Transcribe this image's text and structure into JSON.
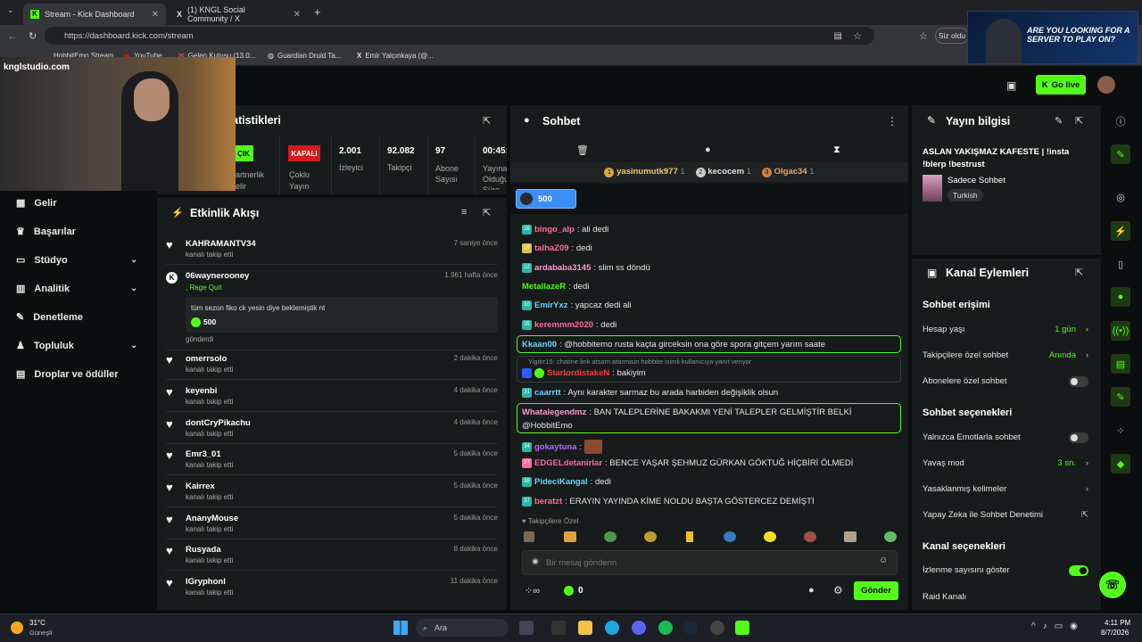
{
  "browser": {
    "tabs": [
      {
        "label": "Stream - Kick Dashboard"
      },
      {
        "label": "(1) KNGL Social Community / X"
      }
    ],
    "url": "https://dashboard.kick.com/stream",
    "bookmarks": [
      "HobbitEmo Stream",
      "YouTube",
      "Gelen Kutusu (13.0...",
      "Guardian Druid Ta...",
      "Emir Yalçınkaya (@..."
    ],
    "profile_text": "Siz oldu",
    "ad_text": "ARE YOU LOOKING FOR A SERVER TO PLAY ON?"
  },
  "overlay": {
    "watermark": "knglstudio.com"
  },
  "topbar": {
    "go_live": "Go live"
  },
  "sidebar": {
    "items": [
      {
        "label": "Gelir",
        "icon": "revenue-icon"
      },
      {
        "label": "Başarılar",
        "icon": "trophy-icon"
      },
      {
        "label": "Stüdyo",
        "icon": "studio-icon"
      },
      {
        "label": "Analitik",
        "icon": "chart-icon"
      },
      {
        "label": "Denetleme",
        "icon": "wrench-icon"
      },
      {
        "label": "Topluluk",
        "icon": "community-icon"
      },
      {
        "label": "Droplar ve ödüller",
        "icon": "gift-icon"
      }
    ]
  },
  "stats": {
    "title_fragment": "atistikleri",
    "partner_status": "ÇIK",
    "partner_label": "artnerlik\nelir",
    "multistream_status": "KAPALI",
    "multistream_label": "Çoklu\nYayın",
    "viewers": "2.001",
    "viewers_label": "İzleyici",
    "followers": "92.082",
    "followers_label": "Takipçi",
    "subs": "97",
    "subs_label": "Abone\nSayısı",
    "uptime": "00:45:",
    "uptime_label": "Yayına\nOlduğu\nSüre"
  },
  "activity": {
    "title": "Etkinlik Akışı",
    "items": [
      {
        "name": "KAHRAMANTV34",
        "sub": "kanalı takip etti",
        "time": "7 saniye önce"
      },
      {
        "name": "omerrsolo",
        "sub": "kanalı takip etti",
        "time": "2 dakika önce"
      },
      {
        "name": "keyenbi",
        "sub": "kanalı takip etti",
        "time": "4 dakika önce"
      },
      {
        "name": "dontCryPikachu",
        "sub": "kanalı takip etti",
        "time": "4 dakika önce"
      },
      {
        "name": "Emr3_01",
        "sub": "kanalı takip etti",
        "time": "5 dakika önce"
      },
      {
        "name": "Kairrex",
        "sub": "kanalı takip etti",
        "time": "5 dakika önce"
      },
      {
        "name": "AnanyMouse",
        "sub": "kanalı takip etti",
        "time": "5 dakika önce"
      },
      {
        "name": "Rusyada",
        "sub": "kanalı takip etti",
        "time": "8 dakika önce"
      },
      {
        "name": "IGryphonl",
        "sub": "kanalı takip etti",
        "time": "11 dakika önce"
      }
    ],
    "special": {
      "name": "06waynerooney",
      "tag": ", Rage Quit",
      "time": "1.961 hafta önce",
      "message": "tüm sezon fiko ck yesin diye beklemiştik nt",
      "amount": "500",
      "footer": "gönderdi"
    }
  },
  "chat": {
    "title": "Sohbet",
    "top_gifters": [
      {
        "rank": "1",
        "name": "yasinumutk977",
        "count": "1"
      },
      {
        "rank": "2",
        "name": "kecocem",
        "count": "1"
      },
      {
        "rank": "3",
        "name": "Olgac34",
        "count": "1"
      }
    ],
    "pinned_amount": "500",
    "messages": [
      {
        "badge": "26",
        "user": "bingo_alp",
        "color": "#ff6b9d",
        "text": ": ali dedi"
      },
      {
        "badge": "16",
        "user": "talhaZ09",
        "color": "#ff6b9d",
        "text": ": dedi"
      },
      {
        "badge": "22",
        "user": "ardababa3145",
        "color": "#ff9bd6",
        "text": ": slim ss döndü"
      },
      {
        "badge": "",
        "user": "MetallazeR",
        "color": "#53fc18",
        "text": ": dedi"
      },
      {
        "badge": "30",
        "user": "EmirYxz",
        "color": "#6bd4ff",
        "text": ": yapcaz dedi ali"
      },
      {
        "badge": "35",
        "user": "keremmm2020",
        "color": "#ff6b9d",
        "text": ": dedi"
      },
      {
        "badge": "",
        "user": "Kkaan00",
        "color": "#6bd4ff",
        "text": ": @hobbitemo rusta kaçta girceksin ona göre spora gitçem yarım saate"
      },
      {
        "badge": "",
        "user": "StarlordistakeN",
        "color": "#ff3b3b",
        "text": ": bakiyim"
      },
      {
        "badge": "31",
        "user": "caarrtt",
        "color": "#6bd4ff",
        "text": ": Aynı karakter sarmaz bu arada harbiden değişiklik olsun"
      },
      {
        "badge": "",
        "user": "Whatalegendmz",
        "color": "#ff9bd6",
        "text": ": BAN TALEPLERİNE BAKAKMI YENİ TALEPLER GELMİŞTİR BELKİ"
      },
      {
        "badge": "",
        "user": "",
        "color": "#ffffff",
        "text": "@HobbitEmo"
      },
      {
        "badge": "34",
        "user": "gokaytuna",
        "color": "#b06bff",
        "text": ":"
      },
      {
        "badge": "27",
        "user": "EDGELdetanirlar",
        "color": "#ff6b9d",
        "text": ": BENCE YAŞAR ŞEHMUZ GÜRKAN GÖKTUĞ HİÇBİRİ ÖLMEDİ"
      },
      {
        "badge": "38",
        "user": "PideciKangal",
        "color": "#6bd4ff",
        "text": ": dedi"
      },
      {
        "badge": "37",
        "user": "beratzt",
        "color": "#ff6b9d",
        "text": ": ERAYIN YAYINDA KİME NOLDU BAŞTA GÖSTERCEZ DEMİŞTİ"
      }
    ],
    "reply_ref": "Yigitrr15: chatine link atsam atarmisin hobbite isimli kullanıcıya yanıt veriyor",
    "followers_only": "Takipçilere Özel",
    "input_placeholder": "Bir mesaj gönderin",
    "points": "0",
    "send": "Gönder"
  },
  "stream_info": {
    "title": "Yayın bilgisi",
    "stream_title": "ASLAN YAKIŞMAZ KAFESTE | !insta !blerp !bestrust",
    "category": "Sadece Sohbet",
    "tag": "Turkish"
  },
  "channel_actions": {
    "title": "Kanal Eylemleri",
    "chat_access_header": "Sohbet erişimi",
    "account_age": {
      "label": "Hesap yaşı",
      "value": "1 gün"
    },
    "followers_chat": {
      "label": "Takipçilere özel sohbet",
      "value": "Anında"
    },
    "subs_chat": {
      "label": "Abonelere özel sohbet"
    },
    "chat_options_header": "Sohbet seçenekleri",
    "emote_only": {
      "label": "Yalnızca Emotlarla sohbet"
    },
    "slow_mode": {
      "label": "Yavaş mod",
      "value": "3 sn."
    },
    "banned_words": {
      "label": "Yasaklanmış kelimeler"
    },
    "ai_moderation": {
      "label": "Yapay Zeka ile Sohbet Denetimi"
    },
    "channel_options_header": "Kanal seçenekleri",
    "show_viewers": {
      "label": "İzlenme sayısını göster"
    },
    "raid": {
      "label": "Raid Kanalı"
    }
  },
  "taskbar": {
    "weather_temp": "31°C",
    "weather_text": "Güneşli",
    "search": "Ara",
    "time": "4:11 PM",
    "date": "8/7/2026"
  },
  "colors": {
    "accent": "#53fc18",
    "panel": "#181b1c",
    "bg": "#0b0e0f"
  }
}
